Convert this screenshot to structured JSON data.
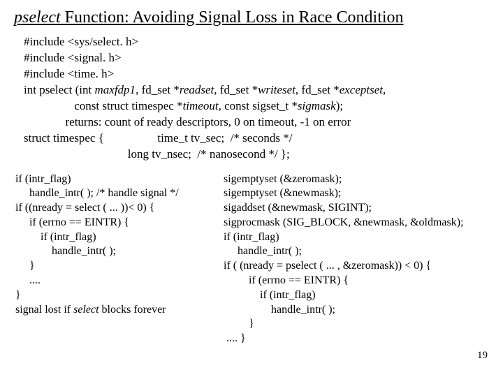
{
  "title": {
    "fname": "pselect",
    "rest": " Function: Avoiding Signal Loss in Race Condition"
  },
  "decl": {
    "l1": "#include <sys/select. h>",
    "l2": "#include <signal. h>",
    "l3": "#include <time. h>",
    "l4a": "int pselect (int ",
    "l4b": "maxfdp1",
    "l4c": ", fd_set *",
    "l4d": "readset",
    "l4e": ", fd_set *",
    "l4f": "writeset",
    "l4g": ", fd_set *",
    "l4h": "exceptset",
    "l4i": ",",
    "l5a": "                 const struct timespec *",
    "l5b": "timeout",
    "l5c": ", const sigset_t *",
    "l5d": "sigmask",
    "l5e": ");",
    "l6": "              returns: count of ready descriptors, 0 on timeout, -1 on error",
    "l7": "struct timespec {                  time_t tv_sec;  /* seconds */",
    "l8": "                                   long tv_nsec;  /* nanosecond */ };"
  },
  "left": {
    "l1": "if (intr_flag)",
    "l2": "     handle_intr( ); /* handle signal */",
    "l3": "if ((nready = select ( ... ))< 0) {",
    "l4": "     if (errno == EINTR) {",
    "l5": "         if (intr_flag)",
    "l6": "             handle_intr( );",
    "l7": "     }",
    "l8": "     ....",
    "l9": "}",
    "l10a": "signal lost if ",
    "l10b": "select",
    "l10c": " blocks forever"
  },
  "right": {
    "l1": "sigemptyset (&zeromask);",
    "l2": "sigemptyset (&newmask);",
    "l3": "sigaddset (&newmask, SIGINT);",
    "l4": "sigprocmask (SIG_BLOCK, &newmask, &oldmask);",
    "l5": "if (intr_flag)",
    "l6": "     handle_intr( );",
    "l7": "if ( (nready = pselect ( ... , &zeromask)) < 0) {",
    "l8": "         if (errno == EINTR) {",
    "l9": "             if (intr_flag)",
    "l10": "                 handle_intr( );",
    "l11": "         }",
    "l12": " .... }"
  },
  "pagenum": "19"
}
